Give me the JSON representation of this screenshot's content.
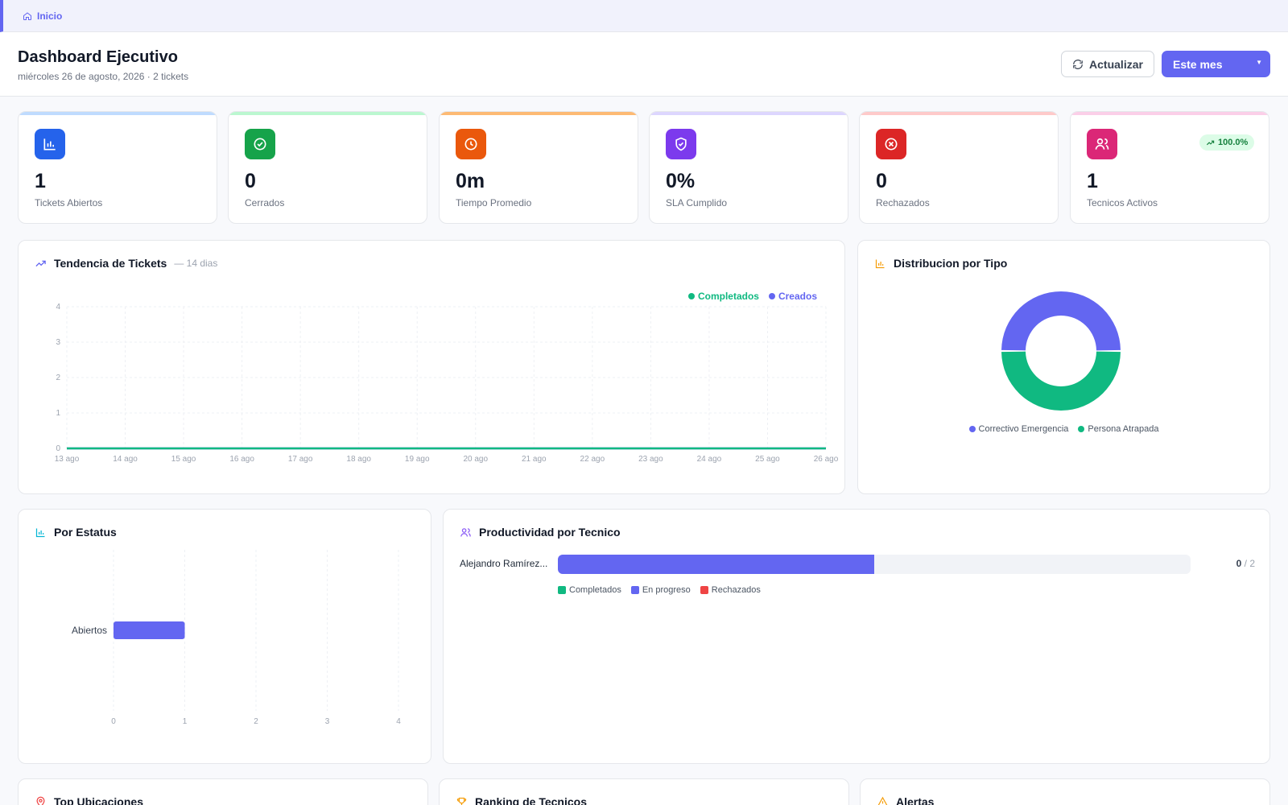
{
  "breadcrumb": {
    "label": "Inicio"
  },
  "header": {
    "title": "Dashboard Ejecutivo",
    "subtitle": "miércoles 26 de agosto, 2026 · 2 tickets",
    "refresh_label": "Actualizar",
    "period_label": "Este mes"
  },
  "kpis": [
    {
      "value": "1",
      "label": "Tickets Abiertos",
      "color": "#2563eb",
      "bar": "#bfdbfe",
      "icon": "bar-chart-icon"
    },
    {
      "value": "0",
      "label": "Cerrados",
      "color": "#16a34a",
      "bar": "#bbf7d0",
      "icon": "check-circle-icon"
    },
    {
      "value": "0m",
      "label": "Tiempo Promedio",
      "color": "#ea580c",
      "bar": "#fdba74",
      "icon": "clock-icon"
    },
    {
      "value": "0%",
      "label": "SLA Cumplido",
      "color": "#7c3aed",
      "bar": "#ddd6fe",
      "icon": "shield-check-icon"
    },
    {
      "value": "0",
      "label": "Rechazados",
      "color": "#dc2626",
      "bar": "#fecaca",
      "icon": "x-circle-icon"
    },
    {
      "value": "1",
      "label": "Tecnicos Activos",
      "color": "#db2777",
      "bar": "#fbcfe8",
      "icon": "users-icon",
      "trend": "100.0%"
    }
  ],
  "trend_card": {
    "title": "Tendencia de Tickets",
    "subtitle": "— 14 dias"
  },
  "distribution_card": {
    "title": "Distribucion por Tipo"
  },
  "status_card": {
    "title": "Por Estatus"
  },
  "productivity_card": {
    "title": "Productividad por Tecnico",
    "rows": [
      {
        "name": "Alejandro Ramírez...",
        "done": "0",
        "total": "2",
        "in_progress_fraction": 0.5
      }
    ],
    "legend": [
      "Completados",
      "En progreso",
      "Rechazados"
    ]
  },
  "bottom_cards": {
    "locations_title": "Top Ubicaciones",
    "ranking_title": "Ranking de Tecnicos",
    "alerts_title": "Alertas"
  },
  "colors": {
    "accent": "#6366f1",
    "green": "#10b981",
    "red": "#ef4444"
  },
  "chart_data": [
    {
      "type": "line",
      "x": [
        "13 ago",
        "14 ago",
        "15 ago",
        "16 ago",
        "17 ago",
        "18 ago",
        "19 ago",
        "20 ago",
        "21 ago",
        "22 ago",
        "23 ago",
        "24 ago",
        "25 ago",
        "26 ago"
      ],
      "series": [
        {
          "name": "Completados",
          "color": "#10b981",
          "values": [
            0,
            0,
            0,
            0,
            0,
            0,
            0,
            0,
            0,
            0,
            0,
            0,
            0,
            0
          ]
        },
        {
          "name": "Creados",
          "color": "#6366f1",
          "values": [
            0,
            0,
            0,
            0,
            0,
            0,
            0,
            0,
            0,
            0,
            0,
            0,
            0,
            0
          ]
        }
      ],
      "yticks": [
        "0",
        "1",
        "2",
        "3",
        "4"
      ],
      "ylim": [
        0,
        4
      ],
      "grid": true,
      "legend": "top-right"
    },
    {
      "type": "pie",
      "labels": [
        "Correctivo Emergencia",
        "Persona Atrapada"
      ],
      "values": [
        1,
        1
      ],
      "colors": [
        "#6366f1",
        "#10b981"
      ],
      "legend": "bottom"
    },
    {
      "type": "bar",
      "orientation": "horizontal",
      "categories": [
        "Abiertos"
      ],
      "values": [
        1
      ],
      "color": "#6366f1",
      "xticks": [
        "0",
        "1",
        "2",
        "3",
        "4"
      ],
      "xlim": [
        0,
        4
      ]
    }
  ]
}
